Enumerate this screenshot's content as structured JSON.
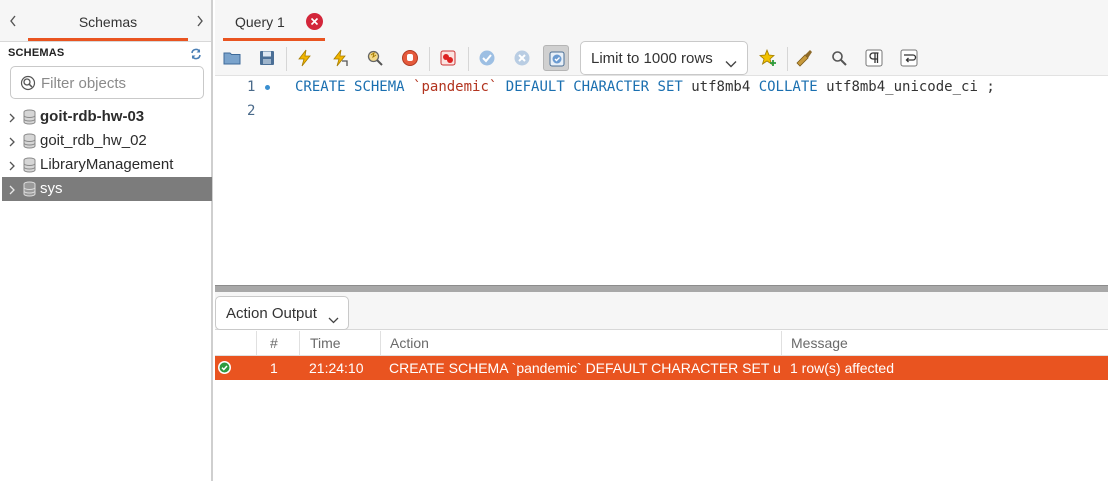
{
  "sidebar": {
    "tab_label": "Schemas",
    "header_label": "SCHEMAS",
    "filter_placeholder": "Filter objects",
    "schemas": [
      {
        "label": "goit-rdb-hw-03",
        "bold": true,
        "selected": false
      },
      {
        "label": "goit_rdb_hw_02",
        "bold": false,
        "selected": false
      },
      {
        "label": "LibraryManagement",
        "bold": false,
        "selected": false
      },
      {
        "label": "sys",
        "bold": false,
        "selected": true
      }
    ]
  },
  "query_tab": {
    "label": "Query 1"
  },
  "toolbar": {
    "icons": [
      "open-folder-icon",
      "save-icon",
      "execute-icon",
      "execute-current-icon",
      "explain-icon",
      "stop-icon",
      "toggle-error-icon",
      "commit-icon",
      "rollback-icon",
      "autocommit-icon",
      "bookmark-icon",
      "beautify-icon",
      "find-icon",
      "invisible-chars-icon",
      "wrap-icon"
    ],
    "limit_label": "Limit to 1000 rows"
  },
  "editor": {
    "line_numbers": [
      "1",
      "2"
    ],
    "tokens": {
      "create": "CREATE",
      "schema": "SCHEMA",
      "name": "`pandemic`",
      "default": "DEFAULT",
      "character": "CHARACTER",
      "set": "SET",
      "charset": "utf8mb4",
      "collate": "COLLATE",
      "collation": "utf8mb4_unicode_ci",
      "semicolon": ";"
    }
  },
  "output": {
    "selector_label": "Action Output",
    "columns": [
      "#",
      "Time",
      "Action",
      "Message"
    ],
    "rows": [
      {
        "num": "1",
        "time": "21:24:10",
        "action": "CREATE SCHEMA `pandemic` DEFAULT CHARACTER SET u...",
        "message": "1 row(s) affected",
        "status": "success"
      }
    ]
  },
  "colors": {
    "accent": "#e95420",
    "keyword": "#1a6fb0",
    "string": "#b2341f",
    "selected_row": "#7c7c7c"
  }
}
